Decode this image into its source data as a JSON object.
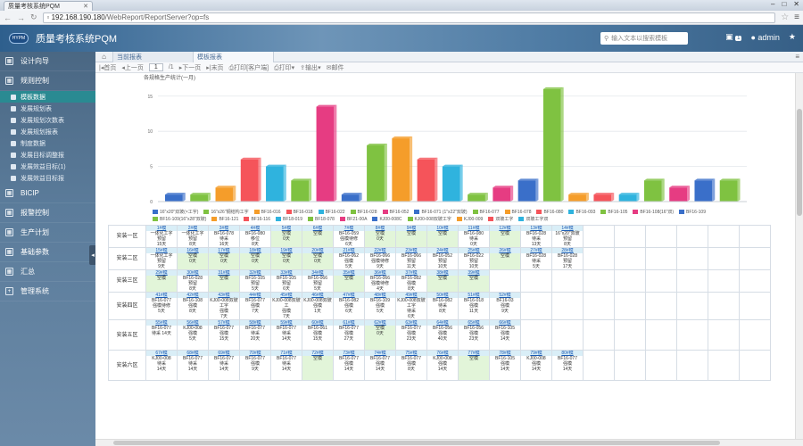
{
  "browser": {
    "tab_title": "质量考核系统PQM",
    "url_host": "192.168.190.180",
    "url_path": "/WebReport/ReportServer?op=fs"
  },
  "app": {
    "logo_text": "HYPM",
    "title": "质量考核系统PQM",
    "search_placeholder": "输入文本以搜索模板",
    "notification_count": "1",
    "user": "admin"
  },
  "sidebar": {
    "items": [
      {
        "label": "设计向导",
        "icon": "grid-icon"
      },
      {
        "label": "规则控制",
        "icon": "grid-icon"
      },
      {
        "label": "BICIP",
        "icon": "grid-icon"
      },
      {
        "label": "报警控制",
        "icon": "grid-icon"
      },
      {
        "label": "生产计划",
        "icon": "grid-icon"
      },
      {
        "label": "基础参数",
        "icon": "grid-icon"
      },
      {
        "label": "汇总",
        "icon": "grid-icon"
      },
      {
        "label": "管理系统",
        "icon": "plus-icon"
      }
    ],
    "subitems": [
      "模板数据",
      "发展规划表",
      "发展规划次数表",
      "发展规划报表",
      "制度数据",
      "发展目标调整报",
      "发展效益目标(1)",
      "发展效益目标报"
    ]
  },
  "report_tabs": [
    "当前报表",
    "模板报表"
  ],
  "toolbar": {
    "first": "首页",
    "prev": "上一页",
    "page": "1",
    "total": "/1",
    "next": "下一页",
    "last": "末页",
    "print": "打印[客户端]",
    "print2": "打印",
    "export": "输出",
    "mail": "邮件"
  },
  "chart_data": {
    "type": "bar",
    "title": "各规格生产统计(一月)",
    "yticks": [
      "0",
      "5",
      "10",
      "15"
    ],
    "ylim": [
      0,
      17
    ],
    "grid": true,
    "values": [
      1,
      1,
      2,
      6,
      5,
      3,
      13.5,
      1,
      8,
      9,
      6,
      5,
      1,
      2,
      3,
      16,
      1,
      1,
      1,
      3,
      2,
      3,
      3
    ],
    "colors": [
      "#3a6fc9",
      "#7fc241",
      "#f59d2a",
      "#f5545a",
      "#2fb3de",
      "#7fc241",
      "#e63c82",
      "#3a6fc9",
      "#7fc241",
      "#f59d2a",
      "#f5545a",
      "#2fb3de",
      "#7fc241",
      "#e63c82",
      "#3a6fc9",
      "#7fc241",
      "#f59d2a",
      "#f5545a",
      "#2fb3de",
      "#7fc241",
      "#e63c82",
      "#3a6fc9",
      "#7fc241"
    ],
    "legend": [
      {
        "label": "16\"x20\"双玻(×工字)",
        "color": "#3a6fc9"
      },
      {
        "label": "16\"x26\"钢结构工字",
        "color": "#7fc241"
      },
      {
        "label": "BF16-016",
        "color": "#f59d2a"
      },
      {
        "label": "BF16-018",
        "color": "#f5545a"
      },
      {
        "label": "BF16-022",
        "color": "#2fb3de"
      },
      {
        "label": "BF16-028",
        "color": "#7fc241"
      },
      {
        "label": "BF16-052",
        "color": "#e63c82"
      },
      {
        "label": "BF16-071 (1\"x22\"双玻)",
        "color": "#3a6fc9"
      },
      {
        "label": "BF16-077",
        "color": "#7fc241"
      },
      {
        "label": "BF16-078",
        "color": "#f59d2a"
      },
      {
        "label": "BF16-080",
        "color": "#f5545a"
      },
      {
        "label": "BF16-093",
        "color": "#2fb3de"
      },
      {
        "label": "BF16-105",
        "color": "#7fc241"
      },
      {
        "label": "BF16-108(16\"双)",
        "color": "#e63c82"
      },
      {
        "label": "BF16-109",
        "color": "#3a6fc9"
      },
      {
        "label": "BF16-109(16\"x28\"双玻)",
        "color": "#7fc241"
      },
      {
        "label": "BF16-121",
        "color": "#f59d2a"
      },
      {
        "label": "BF16-116",
        "color": "#f5545a"
      },
      {
        "label": "BF18-019",
        "color": "#2fb3de"
      },
      {
        "label": "BF18-078",
        "color": "#7fc241"
      },
      {
        "label": "BF21-00A",
        "color": "#e63c82"
      },
      {
        "label": "KJ00-008C",
        "color": "#3a6fc9"
      },
      {
        "label": "KJ00-008双玻工字",
        "color": "#7fc241"
      },
      {
        "label": "KJ00-009",
        "color": "#f59d2a"
      },
      {
        "label": "双玻工字",
        "color": "#f5545a"
      },
      {
        "label": "双玻工字双",
        "color": "#2fb3de"
      }
    ]
  },
  "grid": {
    "rows": [
      {
        "label": "安装一区",
        "cells": [
          {
            "w": "1#模",
            "a": "一体化工字",
            "b": "预留",
            "c": "15天"
          },
          {
            "w": "2#模",
            "a": "一体化工字",
            "b": "预留",
            "c": "8天"
          },
          {
            "w": "3#模",
            "a": "BF16-078",
            "b": "待采",
            "c": "16天"
          },
          {
            "w": "4#模",
            "a": "BF16-080",
            "b": "移位",
            "c": "8天"
          },
          {
            "w": "5#模",
            "a": "空模",
            "b": "",
            "c": "0天",
            "free": true
          },
          {
            "w": "6#模",
            "a": "空模",
            "b": "",
            "c": "",
            "free": true
          },
          {
            "w": "7#模",
            "a": "BF16-059",
            "b": "强模待修",
            "c": "6天"
          },
          {
            "w": "8#模",
            "a": "空模",
            "b": "",
            "c": "0天",
            "free": true
          },
          {
            "w": "9#模",
            "a": "空模",
            "b": "",
            "c": "",
            "free": true
          },
          {
            "w": "10#模",
            "a": "空模",
            "b": "",
            "c": "",
            "free": true
          },
          {
            "w": "11#模",
            "a": "BF16-080",
            "b": "待采",
            "c": "0天"
          },
          {
            "w": "12#模",
            "a": "空模",
            "b": "",
            "c": "",
            "free": true
          },
          {
            "w": "13#模",
            "a": "BF16-028",
            "b": "待采",
            "c": "13天"
          },
          {
            "w": "14#模",
            "a": "16\"x20\"双玻",
            "b": "预留",
            "c": "8天"
          }
        ]
      },
      {
        "label": "安装二区",
        "cells": [
          {
            "w": "15#模",
            "a": "一体化工字",
            "b": "预留",
            "c": "9天"
          },
          {
            "w": "16#模",
            "a": "空模",
            "b": "",
            "c": "0天",
            "free": true
          },
          {
            "w": "17#模",
            "a": "空模",
            "b": "",
            "c": "0天",
            "free": true
          },
          {
            "w": "18#模",
            "a": "空模",
            "b": "",
            "c": "0天",
            "free": true
          },
          {
            "w": "19#模",
            "a": "空模",
            "b": "",
            "c": "0天",
            "free": true
          },
          {
            "w": "20#模",
            "a": "空模",
            "b": "",
            "c": "0天",
            "free": true
          },
          {
            "w": "21#模",
            "a": "BF16-062",
            "b": "强模",
            "c": "5天"
          },
          {
            "w": "22#模",
            "a": "BF16-066",
            "b": "强模待修",
            "c": "9天"
          },
          {
            "w": "23#模",
            "a": "BF16-066",
            "b": "预留",
            "c": "11天"
          },
          {
            "w": "24#模",
            "a": "BF16-052",
            "b": "预留",
            "c": "10天"
          },
          {
            "w": "25#模",
            "a": "BF16-022",
            "b": "预留",
            "c": "10天"
          },
          {
            "w": "26#模",
            "a": "空模",
            "b": "",
            "c": "",
            "free": true
          },
          {
            "w": "27#模",
            "a": "BF16-028",
            "b": "待采",
            "c": "5天"
          },
          {
            "w": "28#模",
            "a": "BF16-028",
            "b": "预留",
            "c": "17天"
          }
        ]
      },
      {
        "label": "安装三区",
        "cells": [
          {
            "w": "29#模",
            "a": "空模",
            "b": "",
            "c": "",
            "free": true
          },
          {
            "w": "30#模",
            "a": "BF16-028",
            "b": "预留",
            "c": "8天"
          },
          {
            "w": "31#模",
            "a": "空模",
            "b": "",
            "c": "",
            "free": true
          },
          {
            "w": "32#模",
            "a": "BF16-105",
            "b": "预留",
            "c": "5天"
          },
          {
            "w": "33#模",
            "a": "BF16-105",
            "b": "预留",
            "c": "6天"
          },
          {
            "w": "34#模",
            "a": "BF16-066",
            "b": "预留",
            "c": "5天"
          },
          {
            "w": "35#模",
            "a": "空模",
            "b": "",
            "c": "",
            "free": true
          },
          {
            "w": "36#模",
            "a": "BF16-066",
            "b": "强模待修",
            "c": "4天"
          },
          {
            "w": "37#模",
            "a": "BF16-082",
            "b": "强模",
            "c": "8天"
          },
          {
            "w": "38#模",
            "a": "空模",
            "b": "",
            "c": "",
            "free": true
          },
          {
            "w": "39#模",
            "a": "空模",
            "b": "",
            "c": "",
            "free": true
          }
        ]
      },
      {
        "label": "安装四区",
        "cells": [
          {
            "w": "41#模",
            "a": "BF16-077",
            "b": "强模待修",
            "c": "5天"
          },
          {
            "w": "42#模",
            "a": "BF16-108",
            "b": "强模",
            "c": "8天"
          },
          {
            "w": "43#模",
            "a": "KJ00-008双玻工字",
            "b": "强模",
            "c": "7天"
          },
          {
            "w": "44#模",
            "a": "BF16-077",
            "b": "强模",
            "c": "7天"
          },
          {
            "w": "45#模",
            "a": "KJ00-008双玻工",
            "b": "强模",
            "c": "7天"
          },
          {
            "w": "46#模",
            "a": "KJ00-008双玻",
            "b": "强模",
            "c": "1天"
          },
          {
            "w": "47#模",
            "a": "BF16-082",
            "b": "强模",
            "c": "6天"
          },
          {
            "w": "48#模",
            "a": "BF16-109",
            "b": "强模",
            "c": "5天"
          },
          {
            "w": "49#模",
            "a": "KJ00-008双玻工字",
            "b": "待采",
            "c": "6天"
          },
          {
            "w": "50#模",
            "a": "BF16-082",
            "b": "待采",
            "c": "8天"
          },
          {
            "w": "51#模",
            "a": "BF16-018",
            "b": "强模",
            "c": "11天"
          },
          {
            "w": "52#模",
            "a": "BF16-03",
            "b": "强模",
            "c": "9天"
          }
        ]
      },
      {
        "label": "安装五区",
        "tall": true,
        "cells": [
          {
            "w": "55#模",
            "a": "BF16-077",
            "b": "待采<br>14天",
            "c": ""
          },
          {
            "w": "56#模",
            "a": "KJ00-008",
            "b": "强模",
            "c": "5天"
          },
          {
            "w": "57#模",
            "a": "BF16-077",
            "b": "强模",
            "c": "15天"
          },
          {
            "w": "58#模",
            "a": "BF16-077",
            "b": "待采",
            "c": "20天"
          },
          {
            "w": "59#模",
            "a": "BF16-077",
            "b": "待采",
            "c": "14天"
          },
          {
            "w": "60#模",
            "a": "BF16-061",
            "b": "强模",
            "c": "15天"
          },
          {
            "w": "61#模",
            "a": "BF16-077",
            "b": "强模",
            "c": "27天"
          },
          {
            "w": "62#模",
            "a": "空模",
            "b": "",
            "c": "0天",
            "free": true
          },
          {
            "w": "63#模",
            "a": "BF16-077",
            "b": "强模",
            "c": "23天"
          },
          {
            "w": "64#模",
            "a": "BF16-056",
            "b": "强模",
            "c": "40天"
          },
          {
            "w": "65#模",
            "a": "BF16-056",
            "b": "强模",
            "c": "23天"
          },
          {
            "w": "66#模",
            "a": "BF16-105",
            "b": "强模",
            "c": "14天"
          }
        ]
      },
      {
        "label": "安装六区",
        "tall": true,
        "cells": [
          {
            "w": "67#模",
            "a": "KJ00-008",
            "b": "待采",
            "c": "14天"
          },
          {
            "w": "68#模",
            "a": "BF16-077",
            "b": "待采",
            "c": "14天"
          },
          {
            "w": "69#模",
            "a": "BF16-077",
            "b": "待采",
            "c": "14天"
          },
          {
            "w": "70#模",
            "a": "BF16-077",
            "b": "强模",
            "c": "9天"
          },
          {
            "w": "71#模",
            "a": "BF16-077",
            "b": "待采",
            "c": "14天"
          },
          {
            "w": "72#模",
            "a": "空模",
            "b": "",
            "c": "",
            "free": true
          },
          {
            "w": "73#模",
            "a": "BF16-077",
            "b": "强模",
            "c": "14天"
          },
          {
            "w": "74#模",
            "a": "BF16-077",
            "b": "强模",
            "c": "14天"
          },
          {
            "w": "75#模",
            "a": "BF16-077",
            "b": "强模",
            "c": "8天"
          },
          {
            "w": "76#模",
            "a": "KJ00-008",
            "b": "强模",
            "c": "14天"
          },
          {
            "w": "77#模",
            "a": "空模",
            "b": "",
            "c": "",
            "free": true
          },
          {
            "w": "78#模",
            "a": "BF16-105",
            "b": "强模",
            "c": "14天"
          },
          {
            "w": "79#模",
            "a": "KJ00-008",
            "b": "强模",
            "c": "14天"
          },
          {
            "w": "80#模",
            "a": "BF16-077",
            "b": "强模",
            "c": "14天"
          }
        ]
      }
    ]
  }
}
